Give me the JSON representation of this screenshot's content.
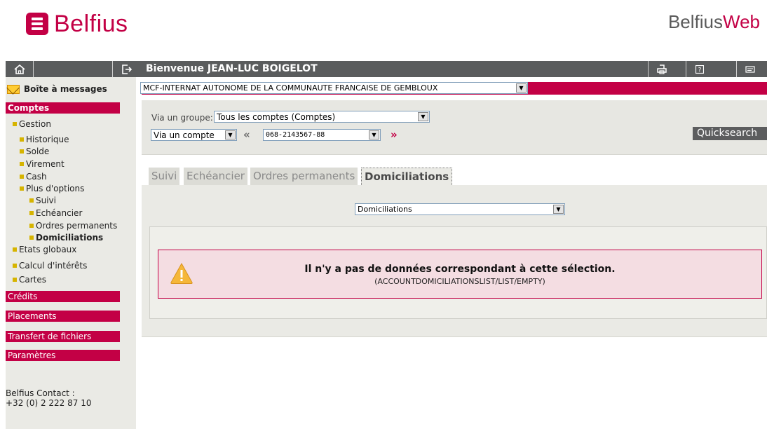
{
  "header": {
    "brand": "Belfius",
    "product_part1": "Belfius",
    "product_part2": "Web"
  },
  "topbar": {
    "welcome": "Bienvenue JEAN-LUC BOIGELOT",
    "icons": [
      "home-icon",
      "logout-icon",
      "print-icon",
      "help-icon",
      "settings-icon"
    ]
  },
  "account": {
    "selected": "MCF-INTERNAT AUTONOME DE LA COMMUNAUTE FRANCAISE DE GEMBLOUX"
  },
  "sidebar": {
    "messages": "Boîte à messages",
    "sections": {
      "comptes": "Comptes",
      "credits": "Crédits",
      "placements": "Placements",
      "transfert": "Transfert de fichiers",
      "parametres": "Paramètres"
    },
    "items": {
      "gestion": "Gestion",
      "historique": "Historique",
      "solde": "Solde",
      "virement": "Virement",
      "cash": "Cash",
      "plus_options": "Plus d'options",
      "suivi": "Suivi",
      "echeancier": "Echéancier",
      "ordres": "Ordres permanents",
      "domiciliations": "Domiciliations",
      "etats": "Etats globaux",
      "calcul": "Calcul d'intérêts",
      "cartes": "Cartes"
    },
    "contact_line1": "Belfius Contact :",
    "contact_line2": "+32 (0) 2 222 87 10"
  },
  "filters": {
    "group_label": "Via un groupe:",
    "group_value": "Tous les comptes (Comptes)",
    "mode_value": "Via un compte",
    "account_number": "068-2143567-88",
    "quicksearch": "Quicksearch"
  },
  "tabs": {
    "suivi": "Suivi",
    "echeancier": "Echéancier",
    "ordres": "Ordres permanents",
    "domiciliations": "Domiciliations"
  },
  "content": {
    "view_select": "Domiciliations",
    "alert_title": "Il n'y a pas de données correspondant à cette sélection.",
    "alert_code": "(ACCOUNTDOMICILIATIONSLIST/LIST/EMPTY)"
  },
  "colors": {
    "brand": "#c30045",
    "dark_bar": "#5a5c5d",
    "panel": "#eaeae5",
    "alert_bg": "#f4dde2"
  }
}
